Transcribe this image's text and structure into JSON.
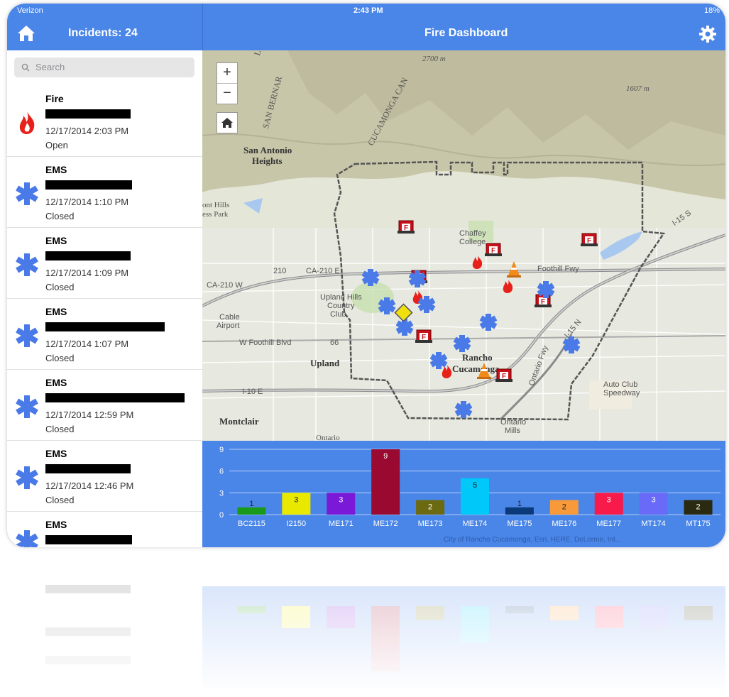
{
  "status_bar": {
    "carrier": "Verizon",
    "time": "2:43 PM",
    "battery": "18%"
  },
  "nav": {
    "incidents_title": "Incidents: 24",
    "dashboard_title": "Fire Dashboard"
  },
  "search": {
    "placeholder": "Search"
  },
  "incidents": [
    {
      "type": "Fire",
      "date": "12/17/2014 2:03 PM",
      "status": "Open",
      "icon": "fire-icon"
    },
    {
      "type": "EMS",
      "date": "12/17/2014 1:10 PM",
      "status": "Closed",
      "icon": "star-of-life-icon"
    },
    {
      "type": "EMS",
      "date": "12/17/2014 1:09 PM",
      "status": "Closed",
      "icon": "star-of-life-icon"
    },
    {
      "type": "EMS",
      "date": "12/17/2014 1:07 PM",
      "status": "Closed",
      "icon": "star-of-life-icon"
    },
    {
      "type": "EMS",
      "date": "12/17/2014 12:59 PM",
      "status": "Closed",
      "icon": "star-of-life-icon"
    },
    {
      "type": "EMS",
      "date": "12/17/2014 12:46 PM",
      "status": "Closed",
      "icon": "star-of-life-icon"
    },
    {
      "type": "EMS",
      "date": "",
      "status": "",
      "icon": "star-of-life-icon"
    }
  ],
  "map": {
    "controls": {
      "zoom_in": "+",
      "zoom_out": "−"
    },
    "labels": {
      "elev1": "2700 m",
      "elev2": "1607 m",
      "san_antonio": "San Antonio",
      "heights": "Heights",
      "chaffey": "Chaffey",
      "college": "College",
      "upland_hills": "Upland Hills",
      "country": "Country",
      "club": "Club",
      "cable": "Cable",
      "airport": "Airport",
      "upland": "Upland",
      "rancho": "Rancho",
      "cucamonga": "Cucamonga",
      "montclair": "Montclair",
      "ontario_mills": "Ontario",
      "mills": "Mills",
      "auto_club": "Auto Club",
      "speedway": "Speedway",
      "foothill_fwy": "Foothill Fwy",
      "ca210e": "CA-210 E",
      "ca210w": "CA-210 W",
      "i10e": "I-10 E",
      "w_foothill": "W Foothill Blvd",
      "ontario_fwy": "Ontario Fwy",
      "i15": "I-15 N",
      "i15s": "I-15 S",
      "ontario": "Ontario",
      "r210": "210",
      "r66": "66",
      "cucamonga_canyon": "CUCAMONGA CAN",
      "los_angeles": "LOS ANGE",
      "san_bern": "SAN BERNAR",
      "lower_hills": "ont Hills",
      "ess_park": "ess Park"
    }
  },
  "chart_data": {
    "type": "bar",
    "categories": [
      "BC2115",
      "I2150",
      "ME171",
      "ME172",
      "ME173",
      "ME174",
      "ME175",
      "ME176",
      "ME177",
      "MT174",
      "MT175"
    ],
    "values": [
      1,
      3,
      3,
      9,
      2,
      5,
      1,
      2,
      3,
      3,
      2
    ],
    "colors": [
      "#1a9a1a",
      "#e8e800",
      "#7a1ad8",
      "#9a0a30",
      "#6b6a10",
      "#00c8f8",
      "#0a3a7a",
      "#f89a3a",
      "#f81a4a",
      "#6a6af8",
      "#2a2a10"
    ],
    "ylim": [
      0,
      9
    ],
    "yticks": [
      "0",
      "3",
      "6",
      "9"
    ],
    "grid": true,
    "xlabel": "",
    "ylabel": "",
    "title": ""
  },
  "attribution": "City of Rancho Cucamonga, Esri, HERE, DeLorme, Int..."
}
